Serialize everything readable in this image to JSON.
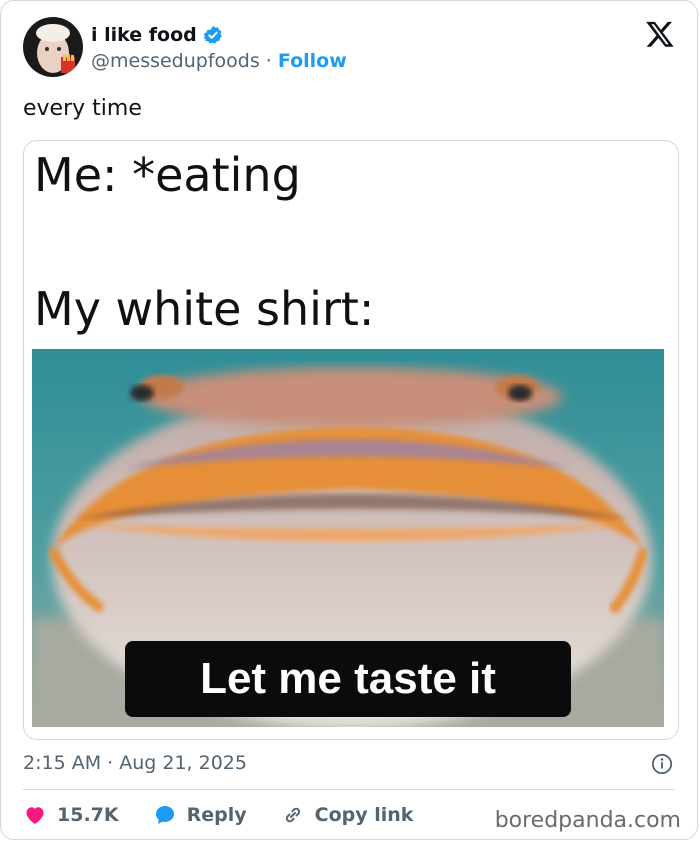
{
  "author": {
    "name": "i like food",
    "handle": "@messedupfoods",
    "separator": "·",
    "follow_label": "Follow"
  },
  "tweet": {
    "text": "every time",
    "timestamp": "2:15 AM · Aug 21, 2025"
  },
  "meme": {
    "line1": "Me: *eating",
    "line2": "My white shirt:",
    "caption": "Let me taste it"
  },
  "actions": {
    "like_count": "15.7K",
    "reply_label": "Reply",
    "copy_label": "Copy link"
  },
  "watermark": "boredpanda.com",
  "colors": {
    "like": "#f91880",
    "reply": "#1d9bf0",
    "accent": "#1d9bf0",
    "muted": "#536471"
  }
}
